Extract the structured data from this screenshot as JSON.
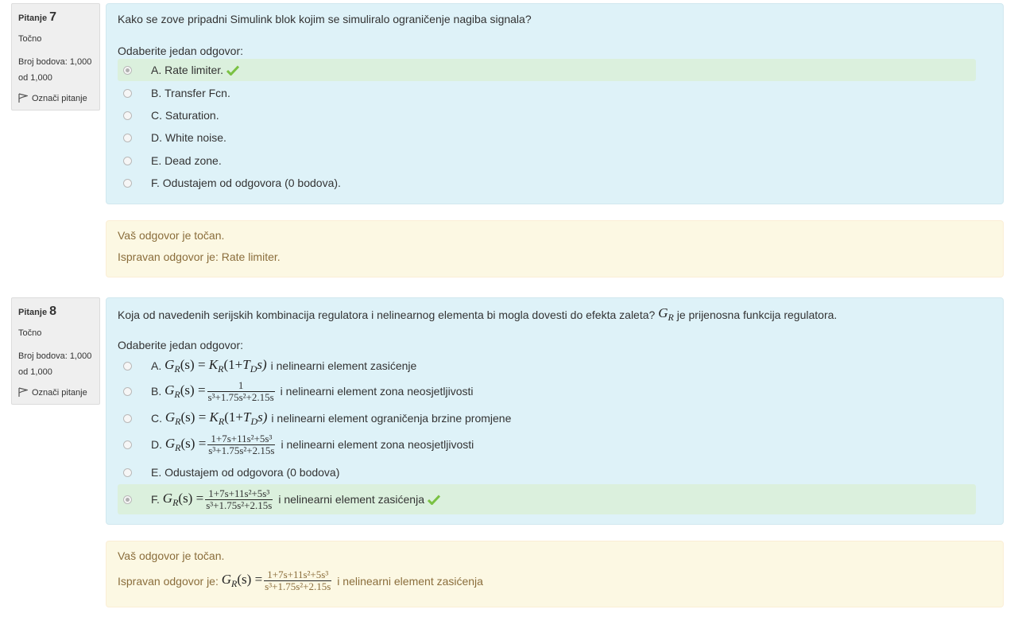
{
  "questions": [
    {
      "number_label": "Pitanje",
      "number": "7",
      "state": "Točno",
      "grade_line1": "Broj bodova: 1,000",
      "grade_line2": "od 1,000",
      "flag_label": "Označi pitanje",
      "text": "Kako se zove pripadni Simulink blok kojim se simuliralo ograničenje nagiba signala?",
      "prompt": "Odaberite jedan odgovor:",
      "options": [
        {
          "letter": "A.",
          "text": "Rate limiter.",
          "checked": true,
          "correct": true
        },
        {
          "letter": "B.",
          "text": "Transfer Fcn."
        },
        {
          "letter": "C.",
          "text": "Saturation."
        },
        {
          "letter": "D.",
          "text": "White noise."
        },
        {
          "letter": "E.",
          "text": "Dead zone."
        },
        {
          "letter": "F.",
          "text": "Odustajem od odgovora (0 bodova)."
        }
      ],
      "feedback": "Vaš odgovor je točan.",
      "right_answer_label": "Ispravan odgovor je:",
      "right_answer": "Rate limiter."
    },
    {
      "number_label": "Pitanje",
      "number": "8",
      "state": "Točno",
      "grade_line1": "Broj bodova: 1,000",
      "grade_line2": "od 1,000",
      "flag_label": "Označi pitanje",
      "text_before": "Koja od navedenih serijskih kombinacija regulatora i nelinearnog elementa bi mogla dovesti do efekta zaleta?",
      "text_math_symbol": "G",
      "text_math_sub": "R",
      "text_after": "je prijenosna funkcija regulatora.",
      "prompt": "Odaberite jedan odgovor:",
      "math": {
        "lhs": "G",
        "lhs_sub": "R",
        "lhs_arg": "(s) =",
        "pid_rhs": "K",
        "pid_sub": "R",
        "pid_paren_open": "(1+",
        "pid_T": "T",
        "pid_T_sub": "D",
        "pid_close": "s)",
        "num_one": "1",
        "num_poly": "1+7s+11s²+5s³",
        "den_poly": "s³+1.75s²+2.15s"
      },
      "options": [
        {
          "letter": "A.",
          "text": "i nelinearni element zasićenje"
        },
        {
          "letter": "B.",
          "text": "i nelinearni element zona neosjetljivosti"
        },
        {
          "letter": "C.",
          "text": "i nelinearni element ograničenja brzine promjene"
        },
        {
          "letter": "D.",
          "text": "i nelinearni element zona neosjetljivosti"
        },
        {
          "letter": "E.",
          "text": "Odustajem od odgovora (0 bodova)"
        },
        {
          "letter": "F.",
          "text": "i nelinearni element zasićenja",
          "checked": true,
          "correct": true
        }
      ],
      "feedback": "Vaš odgovor je točan.",
      "right_answer_label": "Ispravan odgovor je:",
      "right_answer_text": "i nelinearni element zasićenja"
    }
  ],
  "colors": {
    "question_bg": "#def2f8",
    "outcome_bg": "#fcf8e3",
    "correct_bg": "#dbf0dd",
    "check": "#7ac143"
  }
}
